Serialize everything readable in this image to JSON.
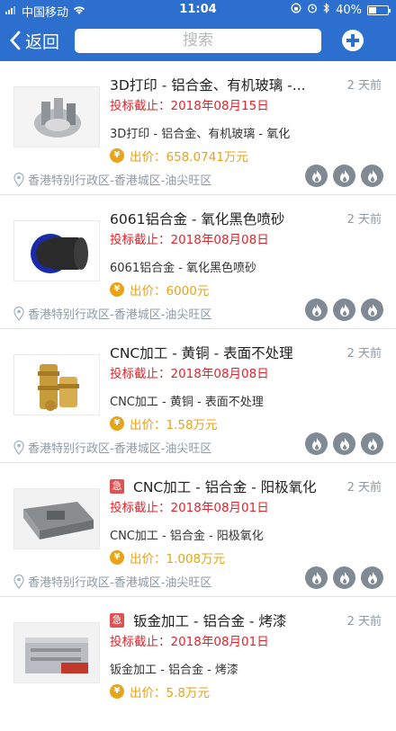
{
  "status": {
    "carrier": "中国移动",
    "time": "11:04",
    "battery": "40%",
    "battery_level": 0.4
  },
  "nav": {
    "back_label": "返回",
    "search_placeholder": "搜索"
  },
  "colors": {
    "brand": "#2d6fcf",
    "deadline": "#e5232a",
    "price": "#e8a317",
    "urgent": "#e05252"
  },
  "items": [
    {
      "title": "3D打印 - 铝合金、有机玻璃 -...",
      "urgent": "",
      "ago": "2 天前",
      "deadline": "投标截止：2018年08月15日",
      "desc": "3D打印 - 铝合金、有机玻璃 - 氧化",
      "price": "出价：658.0741万元",
      "location": "香港特别行政区-香港城区-油尖旺区"
    },
    {
      "title": "6061铝合金 - 氧化黑色喷砂",
      "urgent": "",
      "ago": "2 天前",
      "deadline": "投标截止：2018年08月08日",
      "desc": "6061铝合金 - 氧化黑色喷砂",
      "price": "出价：6000元",
      "location": "香港特别行政区-香港城区-油尖旺区"
    },
    {
      "title": "CNC加工 - 黄铜 - 表面不处理",
      "urgent": "",
      "ago": "2 天前",
      "deadline": "投标截止：2018年08月08日",
      "desc": "CNC加工 - 黄铜 - 表面不处理",
      "price": "出价：1.58万元",
      "location": "香港特别行政区-香港城区-油尖旺区"
    },
    {
      "title": "CNC加工 - 铝合金 - 阳极氧化",
      "urgent": "急",
      "ago": "2 天前",
      "deadline": "投标截止：2018年08月01日",
      "desc": "CNC加工 - 铝合金 - 阳极氧化",
      "price": "出价：1.008万元",
      "location": "香港特别行政区-香港城区-油尖旺区"
    },
    {
      "title": "钣金加工 - 铝合金 - 烤漆",
      "urgent": "急",
      "ago": "2 天前",
      "deadline": "投标截止：2018年08月01日",
      "desc": "钣金加工 - 铝合金 - 烤漆",
      "price": "出价：5.8万元",
      "location": ""
    }
  ]
}
